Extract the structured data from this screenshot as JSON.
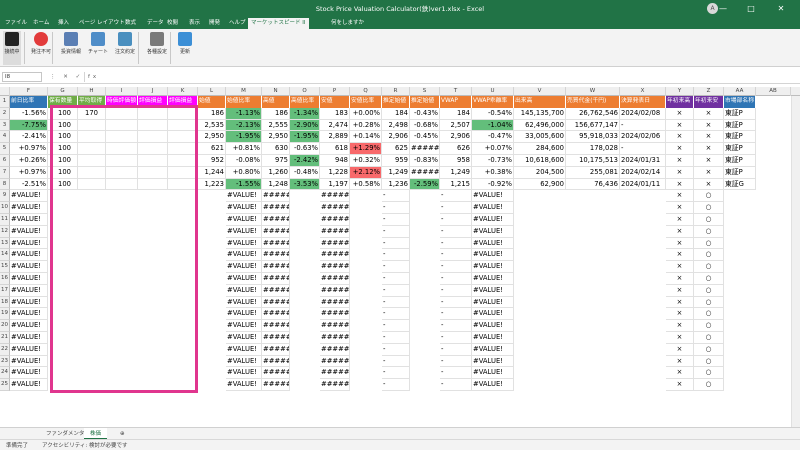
{
  "window": {
    "title": "Stock Price Valuation Calculator(鉄)ver1.xlsx  -  Excel",
    "account_initial": "A"
  },
  "menu": {
    "tabs": [
      "ファイル",
      "ホーム",
      "挿入",
      "ページ レイアウト",
      "数式",
      "データ",
      "校閲",
      "表示",
      "開発",
      "ヘルプ",
      "マーケットスピード II"
    ],
    "search": "何をしますか"
  },
  "ribbon": {
    "buttons": [
      "接続中",
      "発注不可",
      "投資情報",
      "チャート",
      "注文約定",
      "各種設定",
      "更新"
    ]
  },
  "namebox": "I8",
  "fx": "fx",
  "columns": [
    "F",
    "G",
    "H",
    "I",
    "J",
    "K",
    "L",
    "M",
    "N",
    "O",
    "P",
    "Q",
    "R",
    "S",
    "T",
    "U",
    "V",
    "W",
    "X",
    "Y",
    "Z",
    "AA",
    "AB"
  ],
  "header_row": [
    "前日比率",
    "保有数量",
    "平均取得",
    "時価評価額",
    "評価損益",
    "評価損益",
    "始値",
    "始値比率",
    "高値",
    "高値比率",
    "安値",
    "安値比率",
    "推定始値",
    "推定始値",
    "VWAP",
    "VWAP乖離率",
    "出来高",
    "売買代金(千円)",
    "決算発表日",
    "年初来高",
    "年初来安",
    "市場部名称",
    ""
  ],
  "header_colors": [
    "#2f75b5",
    "#70ad47",
    "#70ad47",
    "#ff00ff",
    "#ff00ff",
    "#ff00ff",
    "#ed7d31",
    "#ed7d31",
    "#ed7d31",
    "#ed7d31",
    "#ed7d31",
    "#ed7d31",
    "#ed7d31",
    "#ed7d31",
    "#ed7d31",
    "#ed7d31",
    "#ed7d31",
    "#ed7d31",
    "#ed7d31",
    "#7030a0",
    "#7030a0",
    "#2f75b5",
    "#ffffff"
  ],
  "data_rows": [
    [
      "-1.56%",
      "100",
      "170",
      "",
      "",
      "",
      "186",
      "-1.13%",
      "186",
      "-1.34%",
      "183",
      "+0.00%",
      "184",
      "-0.43%",
      "184",
      "-0.54%",
      "145,135,700",
      "26,762,546",
      "2024/02/08",
      "×",
      "×",
      "東証P"
    ],
    [
      "-7.75%",
      "100",
      "",
      "",
      "",
      "",
      "2,535",
      "-2.13%",
      "2,555",
      "-2.90%",
      "2,474",
      "+0.28%",
      "2,498",
      "-0.68%",
      "2,507",
      "-1.04%",
      "62,496,000",
      "156,677,147",
      "-",
      "×",
      "×",
      "東証P"
    ],
    [
      "-2.41%",
      "100",
      "",
      "",
      "",
      "",
      "2,950",
      "-1.95%",
      "2,950",
      "-1.95%",
      "2,889",
      "+0.14%",
      "2,906",
      "-0.45%",
      "2,906",
      "-0.47%",
      "33,005,600",
      "95,918,033",
      "2024/02/06",
      "×",
      "×",
      "東証P"
    ],
    [
      "+0.97%",
      "100",
      "",
      "",
      "",
      "",
      "621",
      "+0.81%",
      "630",
      "-0.63%",
      "618",
      "+1.29%",
      "625",
      "#####",
      "626",
      "+0.07%",
      "284,600",
      "178,028",
      "-",
      "×",
      "×",
      "東証P"
    ],
    [
      "+0.26%",
      "100",
      "",
      "",
      "",
      "",
      "952",
      "-0.08%",
      "975",
      "-2.42%",
      "948",
      "+0.32%",
      "959",
      "-0.83%",
      "958",
      "-0.73%",
      "10,618,600",
      "10,175,513",
      "2024/01/31",
      "×",
      "×",
      "東証P"
    ],
    [
      "+0.97%",
      "100",
      "",
      "",
      "",
      "",
      "1,244",
      "+0.80%",
      "1,260",
      "-0.48%",
      "1,228",
      "+2.12%",
      "1,249",
      "#####",
      "1,249",
      "+0.38%",
      "204,500",
      "255,081",
      "2024/02/14",
      "×",
      "×",
      "東証P"
    ],
    [
      "-2.51%",
      "100",
      "",
      "",
      "",
      "",
      "1,223",
      "-1.55%",
      "1,248",
      "-3.53%",
      "1,197",
      "+0.58%",
      "1,236",
      "-2.59%",
      "1,215",
      "-0.92%",
      "62,900",
      "76,436",
      "2024/01/11",
      "×",
      "×",
      "東証G"
    ]
  ],
  "error_text": "#VALUE!",
  "hash_text": "#####",
  "dash": "-",
  "circle": "○",
  "cross": "×",
  "error_row_count": 17,
  "sheet_tabs": [
    "ファンダメンタル",
    "株価"
  ],
  "active_tab": "株価",
  "status": {
    "ready": "準備完了",
    "accessibility": "アクセシビリティ: 検討が必要です"
  }
}
